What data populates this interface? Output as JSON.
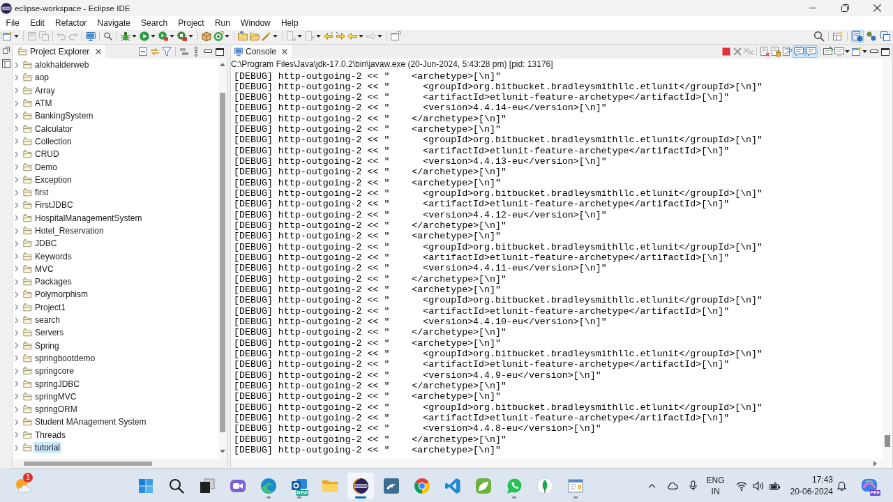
{
  "window": {
    "title": "eclipse-workspace - Eclipse IDE"
  },
  "menu": [
    "File",
    "Edit",
    "Refactor",
    "Navigate",
    "Search",
    "Project",
    "Run",
    "Window",
    "Help"
  ],
  "perspectives": [
    {
      "selected": true
    },
    {
      "selected": false
    },
    {
      "selected": false
    }
  ],
  "project_explorer": {
    "tab": {
      "label": "Project Explorer",
      "selected": true
    },
    "items": [
      {
        "label": "alokhalderweb",
        "expanded": false,
        "selected": false
      },
      {
        "label": "aop",
        "expanded": false,
        "selected": false
      },
      {
        "label": "Array",
        "expanded": false,
        "selected": false
      },
      {
        "label": "ATM",
        "expanded": false,
        "selected": false
      },
      {
        "label": "BankingSystem",
        "expanded": false,
        "selected": false
      },
      {
        "label": "Calculator",
        "expanded": false,
        "selected": false
      },
      {
        "label": "Collection",
        "expanded": false,
        "selected": false
      },
      {
        "label": "CRUD",
        "expanded": false,
        "selected": false
      },
      {
        "label": "Demo",
        "expanded": false,
        "selected": false
      },
      {
        "label": "Exception",
        "expanded": false,
        "selected": false
      },
      {
        "label": "first",
        "expanded": false,
        "selected": false
      },
      {
        "label": "FirstJDBC",
        "expanded": false,
        "selected": false
      },
      {
        "label": "HospitalManagementSystem",
        "expanded": false,
        "selected": false
      },
      {
        "label": "Hotel_Reservation",
        "expanded": false,
        "selected": false
      },
      {
        "label": "JDBC",
        "expanded": false,
        "selected": false
      },
      {
        "label": "Keywords",
        "expanded": false,
        "selected": false
      },
      {
        "label": "MVC",
        "expanded": false,
        "selected": false
      },
      {
        "label": "Packages",
        "expanded": false,
        "selected": false
      },
      {
        "label": "Polymorphism",
        "expanded": false,
        "selected": false
      },
      {
        "label": "Project1",
        "expanded": false,
        "selected": false
      },
      {
        "label": "search",
        "expanded": false,
        "selected": false
      },
      {
        "label": "Servers",
        "expanded": false,
        "selected": false
      },
      {
        "label": "Spring",
        "expanded": false,
        "selected": false
      },
      {
        "label": "springbootdemo",
        "expanded": false,
        "selected": false
      },
      {
        "label": "springcore",
        "expanded": false,
        "selected": false
      },
      {
        "label": "springJDBC",
        "expanded": false,
        "selected": false
      },
      {
        "label": "springMVC",
        "expanded": false,
        "selected": false
      },
      {
        "label": "springORM",
        "expanded": false,
        "selected": false
      },
      {
        "label": "Student MAnagement System",
        "expanded": false,
        "selected": false
      },
      {
        "label": "Threads",
        "expanded": false,
        "selected": false
      },
      {
        "label": "tutorial",
        "expanded": false,
        "selected": true
      }
    ]
  },
  "console": {
    "tab": {
      "label": "Console",
      "selected": true
    },
    "toggles": [
      {
        "on": true
      },
      {
        "on": true
      }
    ],
    "process": "C:\\Program Files\\Java\\jdk-17.0.2\\bin\\javaw.exe (20-Jun-2024, 5:43:28 pm) [pid: 13176]",
    "lines": [
      "[DEBUG] http-outgoing-2 << \"    <archetype>[\\n]\"",
      "[DEBUG] http-outgoing-2 << \"      <groupId>org.bitbucket.bradleysmithllc.etlunit</groupId>[\\n]\"",
      "[DEBUG] http-outgoing-2 << \"      <artifactId>etlunit-feature-archetype</artifactId>[\\n]\"",
      "[DEBUG] http-outgoing-2 << \"      <version>4.4.14-eu</version>[\\n]\"",
      "[DEBUG] http-outgoing-2 << \"    </archetype>[\\n]\"",
      "[DEBUG] http-outgoing-2 << \"    <archetype>[\\n]\"",
      "[DEBUG] http-outgoing-2 << \"      <groupId>org.bitbucket.bradleysmithllc.etlunit</groupId>[\\n]\"",
      "[DEBUG] http-outgoing-2 << \"      <artifactId>etlunit-feature-archetype</artifactId>[\\n]\"",
      "[DEBUG] http-outgoing-2 << \"      <version>4.4.13-eu</version>[\\n]\"",
      "[DEBUG] http-outgoing-2 << \"    </archetype>[\\n]\"",
      "[DEBUG] http-outgoing-2 << \"    <archetype>[\\n]\"",
      "[DEBUG] http-outgoing-2 << \"      <groupId>org.bitbucket.bradleysmithllc.etlunit</groupId>[\\n]\"",
      "[DEBUG] http-outgoing-2 << \"      <artifactId>etlunit-feature-archetype</artifactId>[\\n]\"",
      "[DEBUG] http-outgoing-2 << \"      <version>4.4.12-eu</version>[\\n]\"",
      "[DEBUG] http-outgoing-2 << \"    </archetype>[\\n]\"",
      "[DEBUG] http-outgoing-2 << \"    <archetype>[\\n]\"",
      "[DEBUG] http-outgoing-2 << \"      <groupId>org.bitbucket.bradleysmithllc.etlunit</groupId>[\\n]\"",
      "[DEBUG] http-outgoing-2 << \"      <artifactId>etlunit-feature-archetype</artifactId>[\\n]\"",
      "[DEBUG] http-outgoing-2 << \"      <version>4.4.11-eu</version>[\\n]\"",
      "[DEBUG] http-outgoing-2 << \"    </archetype>[\\n]\"",
      "[DEBUG] http-outgoing-2 << \"    <archetype>[\\n]\"",
      "[DEBUG] http-outgoing-2 << \"      <groupId>org.bitbucket.bradleysmithllc.etlunit</groupId>[\\n]\"",
      "[DEBUG] http-outgoing-2 << \"      <artifactId>etlunit-feature-archetype</artifactId>[\\n]\"",
      "[DEBUG] http-outgoing-2 << \"      <version>4.4.10-eu</version>[\\n]\"",
      "[DEBUG] http-outgoing-2 << \"    </archetype>[\\n]\"",
      "[DEBUG] http-outgoing-2 << \"    <archetype>[\\n]\"",
      "[DEBUG] http-outgoing-2 << \"      <groupId>org.bitbucket.bradleysmithllc.etlunit</groupId>[\\n]\"",
      "[DEBUG] http-outgoing-2 << \"      <artifactId>etlunit-feature-archetype</artifactId>[\\n]\"",
      "[DEBUG] http-outgoing-2 << \"      <version>4.4.9-eu</version>[\\n]\"",
      "[DEBUG] http-outgoing-2 << \"    </archetype>[\\n]\"",
      "[DEBUG] http-outgoing-2 << \"    <archetype>[\\n]\"",
      "[DEBUG] http-outgoing-2 << \"      <groupId>org.bitbucket.bradleysmithllc.etlunit</groupId>[\\n]\"",
      "[DEBUG] http-outgoing-2 << \"      <artifactId>etlunit-feature-archetype</artifactId>[\\n]\"",
      "[DEBUG] http-outgoing-2 << \"      <version>4.4.8-eu</version>[\\n]\"",
      "[DEBUG] http-outgoing-2 << \"    </archetype>[\\n]\"",
      "[DEBUG] http-outgoing-2 << \"    <archetype>[\\n]\""
    ]
  },
  "taskbar": {
    "widget_badge": "1",
    "apps": [
      {
        "kind": "start",
        "running": false,
        "selected": false
      },
      {
        "kind": "search",
        "running": false,
        "selected": false
      },
      {
        "kind": "taskview",
        "running": false,
        "selected": false
      },
      {
        "kind": "video",
        "running": false,
        "selected": false
      },
      {
        "kind": "browser",
        "running": true,
        "selected": false
      },
      {
        "kind": "mail",
        "running": true,
        "selected": false,
        "tag": "NEW"
      },
      {
        "kind": "folder",
        "running": false,
        "selected": false
      },
      {
        "kind": "ide",
        "running": true,
        "selected": true
      },
      {
        "kind": "dolphin",
        "running": false,
        "selected": false
      },
      {
        "kind": "chrome",
        "running": false,
        "selected": false
      },
      {
        "kind": "code",
        "running": false,
        "selected": false
      },
      {
        "kind": "leaf",
        "running": false,
        "selected": false
      },
      {
        "kind": "chat",
        "running": true,
        "selected": false
      },
      {
        "kind": "leafdrop",
        "running": false,
        "selected": false
      },
      {
        "kind": "appwin",
        "running": true,
        "selected": false
      }
    ],
    "tray": {
      "language": "ENG",
      "region": "IN",
      "time": "17:43",
      "date": "20-06-2024",
      "assistant_tag": "PRE"
    }
  }
}
